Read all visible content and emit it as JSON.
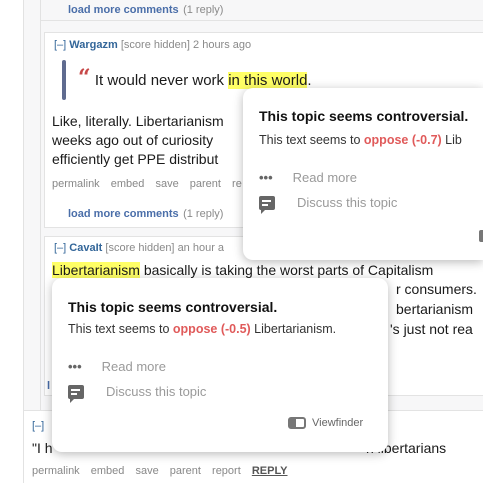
{
  "thread": {
    "load_more_top": {
      "link": "load more comments",
      "count": "(1 reply)"
    },
    "comment_wargazm": {
      "toggle": "[–]",
      "author": "Wargazm",
      "score": "[score hidden]",
      "time": "2 hours ago",
      "quote_glyph": "66",
      "quote_before": "It would never work ",
      "quote_highlight": "in this world",
      "quote_after": ".",
      "body_lines": [
        "Like, literally. Libertarianism",
        "weeks ago out of curiosity",
        "efficiently get PPE distribut"
      ],
      "actions": [
        "permalink",
        "embed",
        "save",
        "parent",
        "re"
      ],
      "load_more": {
        "link": "load more comments",
        "count": "(1 reply)"
      }
    },
    "comment_cavait": {
      "toggle": "[–]",
      "author": "CavaIt",
      "score": "[score hidden]",
      "time": "an hour a",
      "highlight_word": "Libertarianism",
      "body_line1_rest": " basically is taking the worst parts of Capitalism",
      "body_line2_fragment": "r consumers.",
      "body_line3_fragment": "bertarianism",
      "body_line4_fragment": "'s just not rea",
      "stray_letter": "l"
    },
    "bottom_comment": {
      "toggle": "[–]",
      "body_start": "\"I h",
      "body_end": "n libertarians",
      "actions": [
        "permalink",
        "embed",
        "save",
        "parent",
        "report"
      ],
      "reply": "REPLY"
    }
  },
  "popup_right": {
    "title": "This topic seems controversial.",
    "desc_before": "This text seems to ",
    "oppose": "oppose (-0.7)",
    "desc_after": " Lib",
    "read_more": "Read more",
    "discuss": "Discuss this topic",
    "read_more_icon": "more-dots-icon",
    "discuss_icon": "chat-icon"
  },
  "popup_left": {
    "title": "This topic seems controversial.",
    "desc_before": "This text seems to ",
    "oppose": "oppose (-0.5)",
    "desc_after": " Libertarianism.",
    "read_more": "Read more",
    "discuss": "Discuss this topic",
    "viewfinder": "Viewfinder",
    "read_more_icon": "more-dots-icon",
    "discuss_icon": "chat-icon",
    "viewfinder_icon": "viewfinder-toggle-icon"
  },
  "colors": {
    "accent_blue": "#336699",
    "oppose_red": "#e05a5a",
    "highlight_yellow": "#ffff66",
    "quote_bar": "#5f6b8f"
  }
}
